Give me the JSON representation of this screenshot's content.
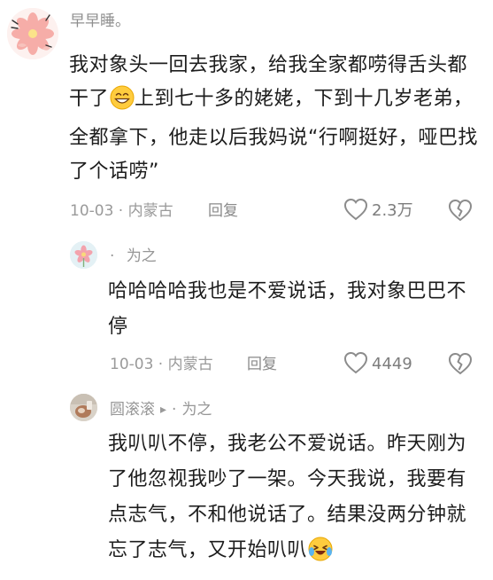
{
  "main_comment": {
    "username": "早早睡。",
    "text_part1": "我对象头一回去我家，给我全家都唠得舌头都干了",
    "text_part2": "上到七十多的姥姥，下到十几岁老弟，全都拿下，他走以后我妈说“行啊挺好，哑巴找了个话唠”",
    "emoji": "grinning-face-emoji",
    "date_location": "10-03 · 内蒙古",
    "reply_label": "回复",
    "like_count": "2.3万"
  },
  "replies": [
    {
      "username_prefix": "·",
      "username": "为之",
      "text": "哈哈哈哈我也是不爱说话，我对象巴巴不停",
      "date_location": "10-03 · 内蒙古",
      "reply_label": "回复",
      "like_count": "4449"
    },
    {
      "username": "圆滚滚",
      "arrow": "▸",
      "separator": "·",
      "reply_to": "为之",
      "text": "我叭叭不停，我老公不爱说话。昨天刚为了他忽视我吵了一架。今天我说，我要有点志气，不和他说话了。结果没两分钟就忘了志气，又开始叭叭",
      "emoji": "crying-laughing-emoji"
    }
  ],
  "colors": {
    "text": "#1d1d1d",
    "meta": "#9a9a9a",
    "icon": "#8c8c8c"
  }
}
